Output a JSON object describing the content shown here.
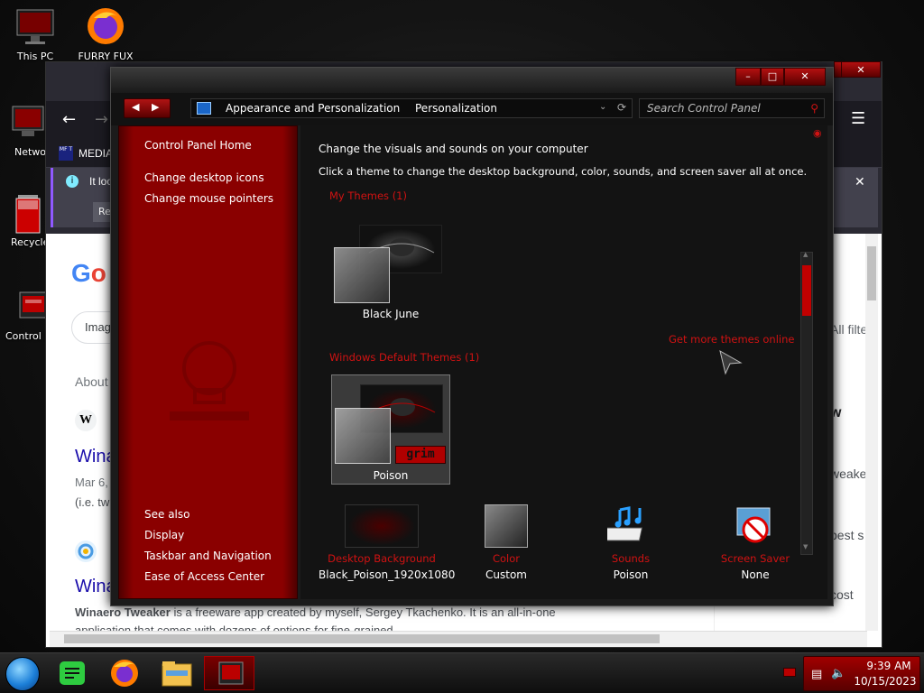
{
  "desktop": {
    "icons": [
      {
        "label": "This PC",
        "icon": "monitor-icon"
      },
      {
        "label": "FURRY FUX",
        "icon": "firefox-icon"
      },
      {
        "label": "Netwo",
        "icon": "network-icon"
      },
      {
        "label": "Recycle",
        "icon": "recycle-bin-icon"
      },
      {
        "label": "Control P",
        "icon": "control-panel-icon"
      }
    ]
  },
  "browser": {
    "media_tab": "MEDIA",
    "notice_text": "It loo",
    "notice_button": "Re",
    "search_chip": "Image",
    "about_text": "About",
    "result1": {
      "title": "Winae",
      "date": "Mar 6,",
      "snippet": "(i.e. tw"
    },
    "result2": {
      "title": "Wina",
      "snippet_bold": "Winaero Tweaker",
      "snippet": " is a freeware app created by myself, Sergey Tkachenko. It is an all-in-one",
      "snippet2": "application that comes with dozens of options for fine-grained"
    },
    "right_panel": [
      "All filter",
      "w",
      "weake",
      "best s",
      "cost"
    ]
  },
  "control_panel": {
    "breadcrumb": [
      "Appearance and Personalization",
      "Personalization"
    ],
    "search_placeholder": "Search Control Panel",
    "sidebar": {
      "home": "Control Panel Home",
      "links": [
        "Change desktop icons",
        "Change mouse pointers"
      ],
      "see_also_heading": "See also",
      "see_also": [
        "Display",
        "Taskbar and Navigation",
        "Ease of Access Center"
      ]
    },
    "heading": "Change the visuals and sounds on your computer",
    "subheading": "Click a theme to change the desktop background, color, sounds, and screen saver all at once.",
    "my_themes_label": "My Themes (1)",
    "theme_black_june": "Black June",
    "get_more": "Get more themes online",
    "default_themes_label": "Windows Default Themes (1)",
    "theme_poison": "Poison",
    "poison_badge": "grim",
    "bottom": [
      {
        "title": "Desktop Background",
        "value": "Black_Poison_1920x1080",
        "icon": "wallpaper-icon"
      },
      {
        "title": "Color",
        "value": "Custom",
        "icon": "color-icon"
      },
      {
        "title": "Sounds",
        "value": "Poison",
        "icon": "sounds-icon"
      },
      {
        "title": "Screen Saver",
        "value": "None",
        "icon": "screensaver-icon"
      }
    ],
    "colors": {
      "accent": "#d01212",
      "sidebar": "#8a0000"
    }
  },
  "taskbar": {
    "time": "9:39 AM",
    "date": "10/15/2023"
  }
}
